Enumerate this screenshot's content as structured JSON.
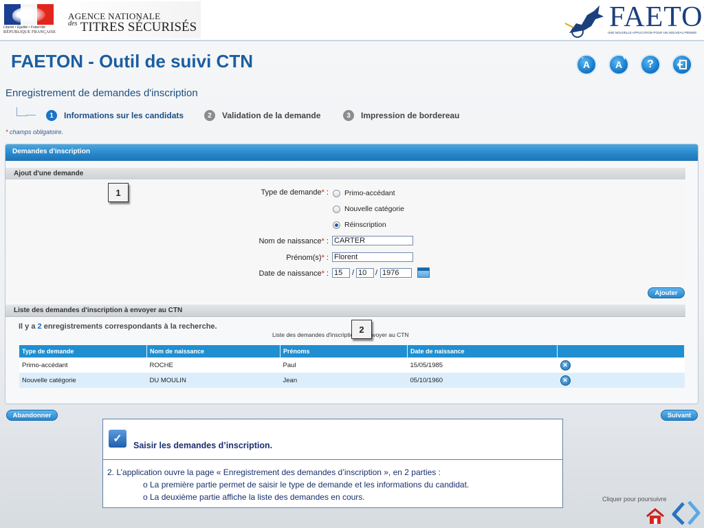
{
  "header": {
    "motto": "Liberté • Égalité • Fraternité",
    "republic": "RÉPUBLIQUE FRANÇAISE",
    "agency_line1": "AGENCE NATIONALE",
    "agency_des": "des",
    "agency_line2": "TITRES SÉCURISÉS",
    "faeton_logo": "FAETON",
    "faeton_tagline": "UNE NOUVELLE APPLICATION POUR UN NOUVEAU PERMIS"
  },
  "app_title": "FAETON - Outil de suivi CTN",
  "toolbar": {
    "font_smaller": "A",
    "font_larger": "A",
    "help": "?",
    "icons": [
      "font-decrease-icon",
      "font-increase-icon",
      "help-icon",
      "logout-icon"
    ]
  },
  "section_title": "Enregistrement de demandes d'inscription",
  "steps": [
    {
      "num": "1",
      "label": "Informations sur les candidats",
      "active": true
    },
    {
      "num": "2",
      "label": "Validation de la demande",
      "active": false
    },
    {
      "num": "3",
      "label": "Impression de bordereau",
      "active": false
    }
  ],
  "required_note": {
    "star": "*",
    "text": " champs obligatoire."
  },
  "panel": {
    "title": "Demandes d'inscription",
    "add_section": "Ajout d'une demande",
    "list_section": "Liste des demandes d'inscription à envoyer au CTN"
  },
  "form": {
    "type_label": "Type de demande",
    "options": [
      "Primo-accédant",
      "Nouvelle catégorie",
      "Réinscription"
    ],
    "selected_option": "Réinscription",
    "nom_label": "Nom de naissance",
    "nom_value": "CARTER",
    "prenom_label": "Prénom(s)",
    "prenom_value": "Florent",
    "date_label": "Date de naissance",
    "date_day": "15",
    "date_month": "10",
    "date_year": "1976",
    "date_sep": "/",
    "star": "*",
    "colon": " :",
    "add_button": "Ajouter"
  },
  "list": {
    "count_prefix": "Il y a ",
    "count": "2",
    "count_suffix": " enregistrements correspondants à la recherche.",
    "caption": "Liste des demandes d'inscriptions à envoyer au CTN",
    "columns": [
      "Type de demande",
      "Nom de naissance",
      "Prénoms",
      "Date de naissance",
      ""
    ],
    "rows": [
      {
        "type": "Primo-accédant",
        "nom": "ROCHE",
        "prenoms": "Paul",
        "date": "15/05/1985"
      },
      {
        "type": "Nouvelle catégorie",
        "nom": "DU MOULIN",
        "prenoms": "Jean",
        "date": "05/10/1960"
      }
    ]
  },
  "buttons": {
    "abandon": "Abandonner",
    "next": "Suivant"
  },
  "annotations": [
    "1",
    "2"
  ],
  "note": {
    "title": "Saisir les demandes d’inscription.",
    "line1": "2.    L’application ouvre la page « Enregistrement des demandes d’inscription »,  en 2 parties :",
    "bullet1": "o     La première partie permet de saisir le type de demande et les informations du candidat.",
    "bullet2": "o     La deuxième partie affiche la liste des demandes en cours."
  },
  "continue_hint": "Cliquer pour poursuivre",
  "colors": {
    "accent": "#1b5ea1",
    "header_bar": "#2685c9",
    "table_head": "#1f8fd1",
    "row_alt": "#dceefb",
    "required": "#d0201e"
  }
}
